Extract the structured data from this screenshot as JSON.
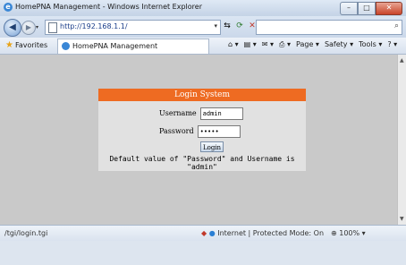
{
  "window": {
    "title": "HomePNA Management - Windows Internet Explorer",
    "buttons": {
      "minimize": "–",
      "maximize": "□",
      "close": "✕"
    }
  },
  "addressbar": {
    "url": "http://192.168.1.1/",
    "back": "◀",
    "forward": "▶",
    "dropdown": "▾",
    "refresh": "⟳",
    "stop": "✕",
    "compat": "⇆",
    "search_icon": "⌕"
  },
  "commandbar": {
    "favorites": "Favorites",
    "tab_label": "HomePNA Management",
    "tools": [
      "⌂ ▾",
      "▤ ▾",
      "✉ ▾",
      "⎙ ▾",
      "Page ▾",
      "Safety ▾",
      "Tools ▾",
      "? ▾"
    ]
  },
  "login": {
    "header": "Login System",
    "username_label": "Username",
    "username_value": "admin",
    "password_label": "Password",
    "password_value": "•••••",
    "button": "Login",
    "note": "Default value of \"Password\" and Username is \"admin\""
  },
  "status": {
    "url": "/tgi/login.tgi",
    "zone": "Internet | Protected Mode: On",
    "zoom": "100%"
  },
  "colors": {
    "login_header": "#ee6b22",
    "content_bg": "#c9c9c9"
  }
}
